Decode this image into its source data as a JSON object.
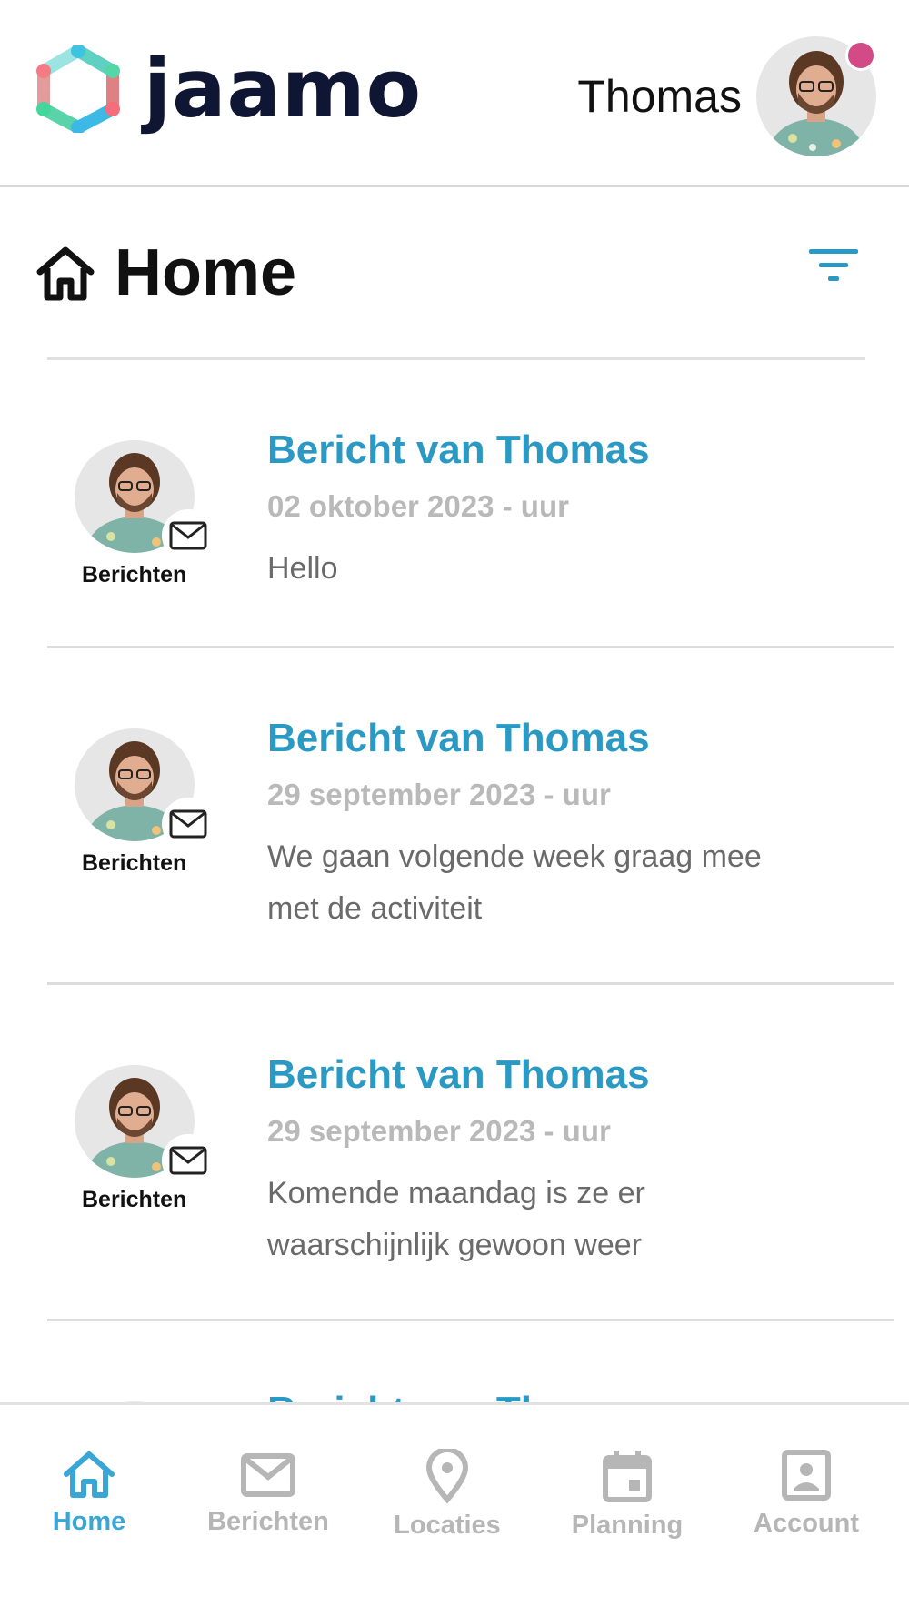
{
  "header": {
    "brand": "jaamo",
    "user_name": "Thomas"
  },
  "page": {
    "title": "Home"
  },
  "feed": [
    {
      "title": "Bericht van Thomas",
      "date": "02 oktober 2023 - uur",
      "body": "Hello",
      "source": "Berichten"
    },
    {
      "title": "Bericht van Thomas",
      "date": "29 september 2023 - uur",
      "body": "We gaan volgende week graag mee met de activiteit",
      "source": "Berichten"
    },
    {
      "title": "Bericht van Thomas",
      "date": "29 september 2023 - uur",
      "body": "Komende maandag is ze er waarschijnlijk gewoon weer",
      "source": "Berichten"
    }
  ],
  "nav": [
    {
      "label": "Home",
      "icon": "home-icon",
      "active": true
    },
    {
      "label": "Berichten",
      "icon": "mail-icon",
      "active": false
    },
    {
      "label": "Locaties",
      "icon": "location-pin-icon",
      "active": false
    },
    {
      "label": "Planning",
      "icon": "calendar-icon",
      "active": false
    },
    {
      "label": "Account",
      "icon": "account-icon",
      "active": false
    }
  ],
  "colors": {
    "accent": "#2a99c4",
    "nav_active": "#3aa6d5",
    "nav_inactive": "#b6b6b6",
    "notification": "#d24a86",
    "brand_text": "#0f1633"
  }
}
